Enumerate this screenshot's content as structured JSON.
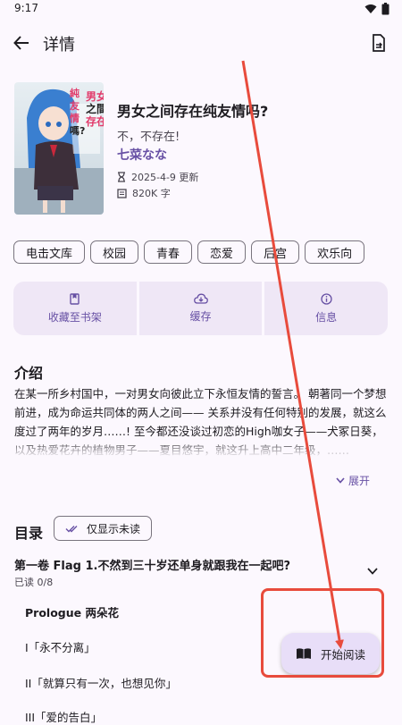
{
  "status_bar": {
    "time": "9:17",
    "wifi_icon": "wifi-icon",
    "battery_icon": "battery-icon"
  },
  "app_bar": {
    "back_icon": "arrow-left-icon",
    "title": "详情",
    "action_icon": "file-swap-icon"
  },
  "book": {
    "title": "男女之间存在纯友情吗?",
    "subtitle": "不，不存在!",
    "author": "七菜なな",
    "updated": "2025-4-9 更新",
    "updated_icon": "hourglass-icon",
    "word_count": "820K 字",
    "word_count_icon": "book-icon",
    "cover_text": "男女之間存在純友情嗎?"
  },
  "tags": [
    "电击文库",
    "校园",
    "青春",
    "恋爱",
    "后宫",
    "欢乐向"
  ],
  "actions": [
    {
      "label": "收藏至书架",
      "icon": "bookmark-icon"
    },
    {
      "label": "缓存",
      "icon": "cloud-download-icon"
    },
    {
      "label": "信息",
      "icon": "info-icon"
    }
  ],
  "intro": {
    "title": "介绍",
    "text": "在某一所乡村国中，一对男女向彼此立下永恒友情的誓言。 朝著同一个梦想前进，成为命运共同体的两人之间—— 关系并没有任何特别的发展，就这么度过了两年的岁月……! 至今都还没谈过初恋的High咖女子——犬冢日葵，以及热爱花卉的植物男子——夏目悠宇，就这升上高中二年级，……",
    "expand_label": "展开",
    "expand_icon": "chevron-down-icon"
  },
  "toc": {
    "title": "目录",
    "filter_label": "仅显示未读",
    "filter_icon": "double-check-icon",
    "volume_title": "第一卷 Flag 1.不然到三十岁还单身就跟我在一起吧?",
    "volume_progress": "已读 0/8",
    "chapters": [
      "Prologue 两朵花",
      "I「永不分离」",
      "II「就算只有一次，也想见你」",
      "III「爱的告白」"
    ]
  },
  "fab": {
    "label": "开始阅读",
    "icon": "open-book-icon"
  },
  "colors": {
    "accent": "#6750a4",
    "annotation": "#e84b3c",
    "background": "#fcf8fe"
  }
}
